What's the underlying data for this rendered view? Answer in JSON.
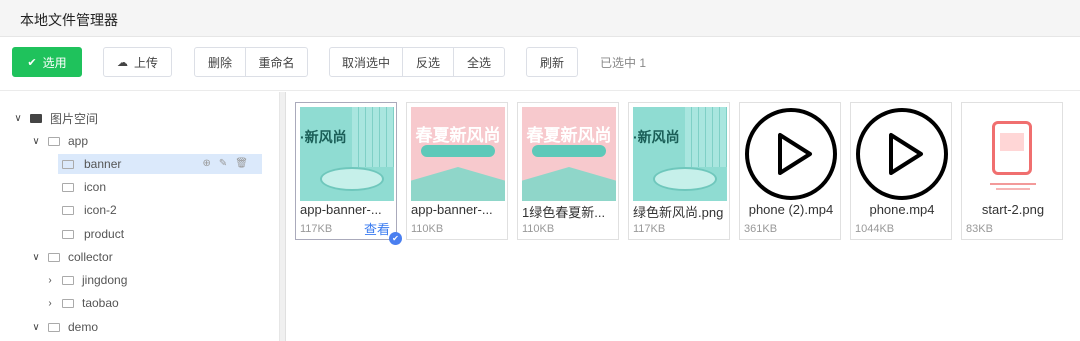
{
  "header": {
    "title": "本地文件管理器"
  },
  "toolbar": {
    "select_label": "选用",
    "upload_label": "上传",
    "delete_label": "删除",
    "rename_label": "重命名",
    "deselect_label": "取消选中",
    "invert_label": "反选",
    "selectall_label": "全选",
    "refresh_label": "刷新",
    "status": "已选中 1"
  },
  "tree": {
    "root": "图片空间",
    "app": "app",
    "banner": "banner",
    "icon": "icon",
    "icon2": "icon-2",
    "product": "product",
    "collector": "collector",
    "jingdong": "jingdong",
    "taobao": "taobao",
    "demo": "demo"
  },
  "files": [
    {
      "name": "app-banner-...",
      "size": "117KB",
      "view": "查看"
    },
    {
      "name": "app-banner-...",
      "size": "110KB"
    },
    {
      "name": "1绿色春夏新...",
      "size": "110KB"
    },
    {
      "name": "绿色新风尚.png",
      "size": "117KB"
    },
    {
      "name": "phone (2).mp4",
      "size": "361KB"
    },
    {
      "name": "phone.mp4",
      "size": "1044KB"
    },
    {
      "name": "start-2.png",
      "size": "83KB"
    }
  ],
  "thumb_text": {
    "a": "·新风尚",
    "b": "春夏新风尚",
    "c": "春夏新风尚",
    "d": "·新风尚"
  },
  "colors": {
    "primary": "#1fc25c",
    "accent": "#3a7bf0",
    "teal": "#7fd6cf",
    "pink": "#f8c8cf"
  }
}
